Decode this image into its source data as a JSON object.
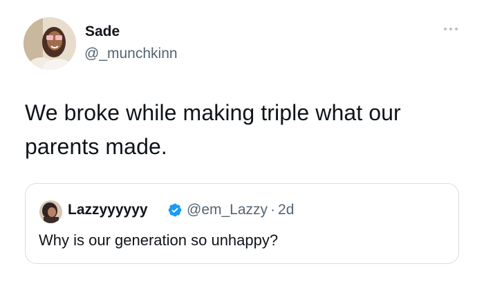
{
  "tweet": {
    "author": {
      "display_name": "Sade",
      "handle": "@_munchkinn",
      "avatar_icon": "profile-photo"
    },
    "more_icon": "more-horizontal-icon",
    "text": "We broke while making triple what our parents made.",
    "quoted_tweet": {
      "author": {
        "display_name": "Lazzyyyyyy",
        "handle": "@em_Lazzy",
        "verified": true,
        "avatar_icon": "profile-photo"
      },
      "separator": "·",
      "age": "2d",
      "text": "Why is our generation so unhappy?"
    }
  },
  "colors": {
    "text_primary": "#0f1419",
    "text_secondary": "#536471",
    "verified_blue": "#1d9bf0",
    "border": "#d7dde2"
  }
}
